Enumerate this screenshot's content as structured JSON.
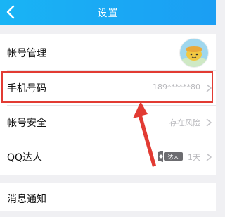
{
  "header": {
    "title": "设置",
    "back_icon": "chevron-left-icon",
    "colors": {
      "start": "#19b4f5",
      "end": "#1b9ef3"
    }
  },
  "rows": {
    "account": {
      "label": "帐号管理",
      "avatar_icon": "avatar-icon"
    },
    "phone": {
      "label": "手机号码",
      "value": "189******80"
    },
    "security": {
      "label": "帐号安全",
      "value": "存在风险"
    },
    "qq_master": {
      "label": "QQ达人",
      "badge_text": "达人",
      "days": "1天"
    },
    "notifications": {
      "label": "消息通知"
    }
  },
  "annotation": {
    "highlight_color": "#e23b33",
    "arrow_icon": "red-arrow-icon"
  }
}
